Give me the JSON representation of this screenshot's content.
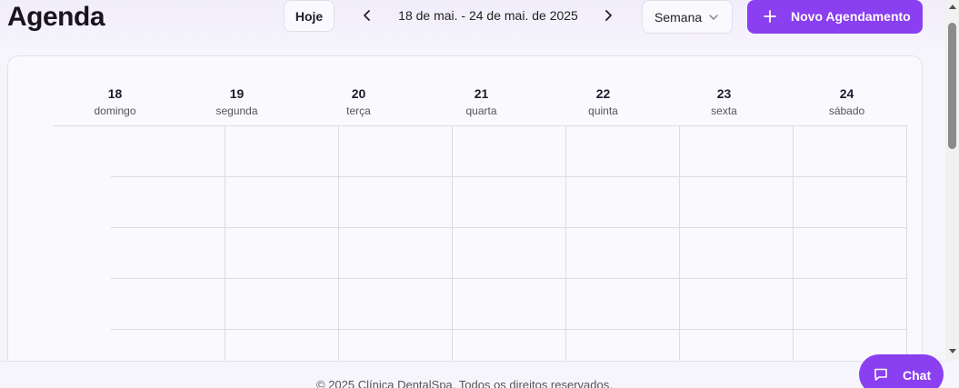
{
  "header": {
    "title": "Agenda",
    "today_label": "Hoje",
    "date_range": "18 de mai. - 24 de mai. de 2025",
    "view_selected": "Semana",
    "new_button_label": "Novo Agendamento"
  },
  "calendar": {
    "days": [
      {
        "number": "18",
        "name": "domingo"
      },
      {
        "number": "19",
        "name": "segunda"
      },
      {
        "number": "20",
        "name": "terça"
      },
      {
        "number": "21",
        "name": "quarta"
      },
      {
        "number": "22",
        "name": "quinta"
      },
      {
        "number": "23",
        "name": "sexta"
      },
      {
        "number": "24",
        "name": "sábado"
      }
    ]
  },
  "footer": {
    "text": "© 2025 Clínica DentalSpa. Todos os direitos reservados."
  },
  "chat": {
    "label": "Chat"
  },
  "colors": {
    "accent": "#8a3ff0",
    "background": "#f7f5fc",
    "grid": "#dedbe4"
  },
  "icons": {
    "prev": "chevron-left-icon",
    "next": "chevron-right-icon",
    "select": "chevron-down-icon",
    "add": "plus-icon",
    "chat": "chat-bubble-icon"
  }
}
